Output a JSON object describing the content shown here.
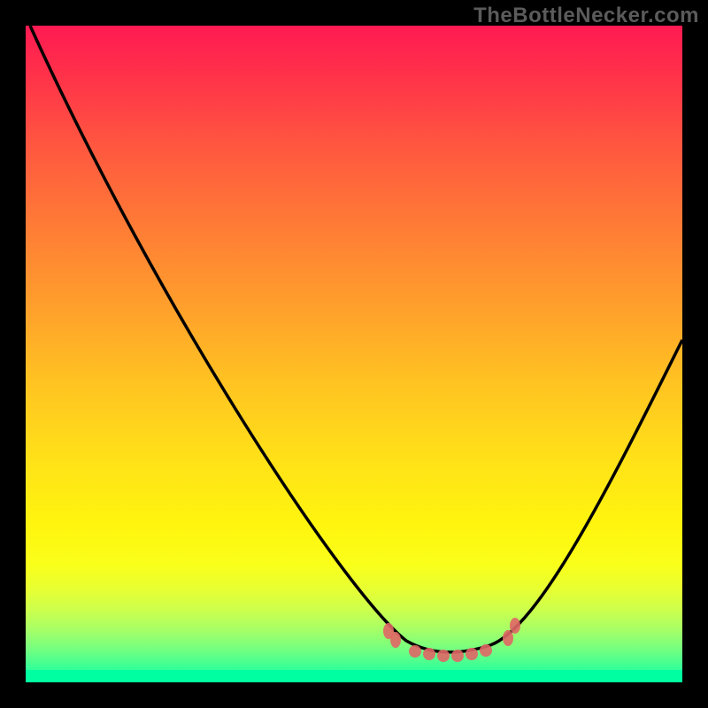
{
  "watermark": "TheBottleNecker.com",
  "chart_data": {
    "type": "line",
    "title": "",
    "xlabel": "",
    "ylabel": "",
    "xlim": [
      0,
      100
    ],
    "ylim": [
      0,
      100
    ],
    "grid": false,
    "legend": false,
    "background": "vertical-gradient red→yellow→green",
    "description": "V-shaped bottleneck curve on a red-to-green heat gradient; minimum (optimal match) cluster marked in pale-red near x≈60–75, y≈3–5. Left branch starts top-left at y≈100 and descends; right branch rises toward x=100, y≈52.",
    "series": [
      {
        "name": "bottleneck-curve",
        "x": [
          0,
          10,
          20,
          30,
          40,
          50,
          56,
          60,
          64,
          68,
          72,
          76,
          80,
          86,
          92,
          100
        ],
        "values": [
          100,
          82,
          65,
          50,
          36,
          22,
          12,
          6,
          3,
          3,
          4,
          8,
          16,
          28,
          40,
          52
        ]
      }
    ],
    "markers": {
      "name": "optimal-region",
      "color": "#e06666",
      "x": [
        55,
        56,
        59,
        61,
        64,
        66,
        68,
        70,
        73,
        75
      ],
      "values": [
        8,
        6,
        5,
        4,
        3,
        3,
        4,
        5,
        6,
        8
      ]
    },
    "gradient_stops": [
      {
        "pos": 0.0,
        "color": "#ff1a52"
      },
      {
        "pos": 0.3,
        "color": "#ff7a36"
      },
      {
        "pos": 0.66,
        "color": "#ffe118"
      },
      {
        "pos": 0.88,
        "color": "#ccff4d"
      },
      {
        "pos": 1.0,
        "color": "#00ffa0"
      }
    ]
  }
}
